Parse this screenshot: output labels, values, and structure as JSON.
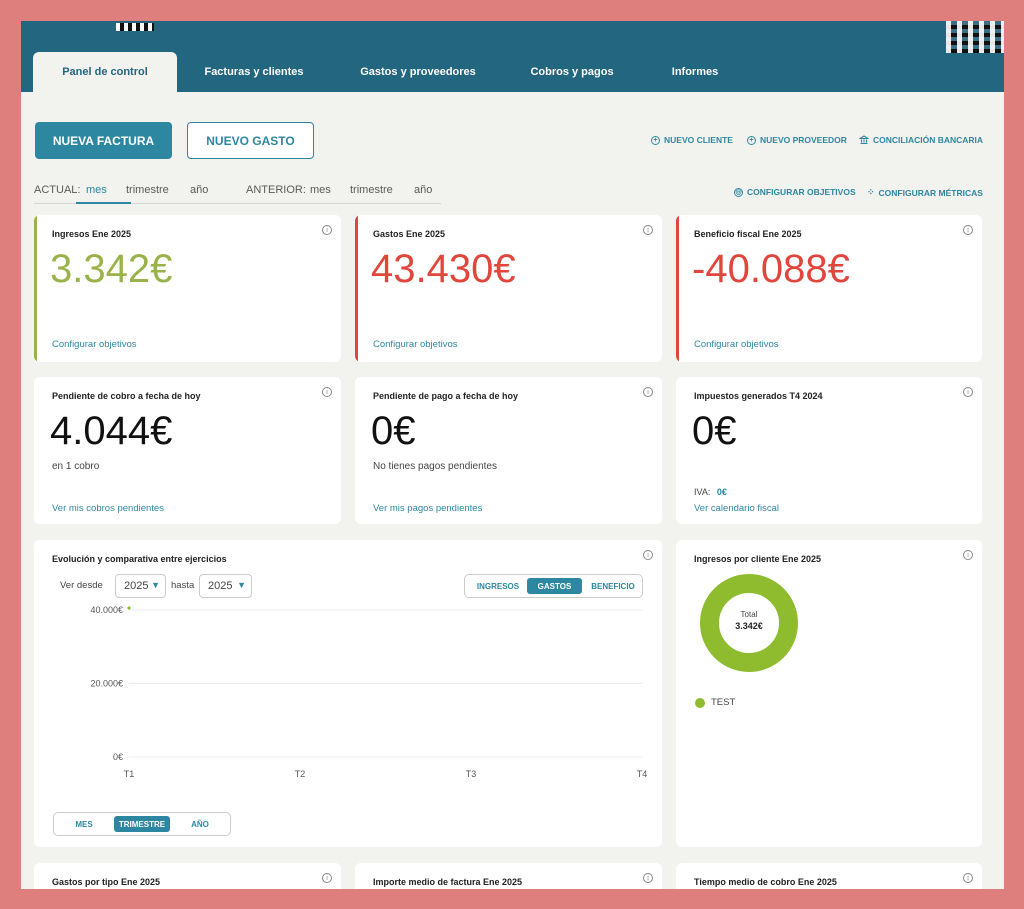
{
  "tabs": [
    {
      "label": "Panel de control"
    },
    {
      "label": "Facturas y clientes"
    },
    {
      "label": "Gastos y proveedores"
    },
    {
      "label": "Cobros y pagos"
    },
    {
      "label": "Informes"
    }
  ],
  "actions": {
    "new_invoice": "NUEVA FACTURA",
    "new_expense": "NUEVO GASTO",
    "new_client": "NUEVO CLIENTE",
    "new_supplier": "NUEVO PROVEEDOR",
    "bank_reconciliation": "CONCILIACIÓN BANCARIA",
    "configure_goals": "CONFIGURAR OBJETIVOS",
    "configure_metrics": "CONFIGURAR MÉTRICAS"
  },
  "periods": {
    "current_label": "ACTUAL:",
    "previous_label": "ANTERIOR:",
    "options": [
      "mes",
      "trimestre",
      "año"
    ],
    "selected": "mes"
  },
  "cards": {
    "income": {
      "title": "Ingresos Ene 2025",
      "value": "3.342€",
      "link": "Configurar objetivos",
      "color": "#9ab24a"
    },
    "expenses": {
      "title": "Gastos Ene 2025",
      "value": "43.430€",
      "link": "Configurar objetivos",
      "color": "#e1463c"
    },
    "profit": {
      "title": "Beneficio fiscal Ene 2025",
      "value": "-40.088€",
      "link": "Configurar objetivos",
      "color": "#e1463c"
    },
    "receivable": {
      "title": "Pendiente de cobro a fecha de hoy",
      "value": "4.044€",
      "sub": "en 1 cobro",
      "link": "Ver mis cobros pendientes"
    },
    "payable": {
      "title": "Pendiente de pago a fecha de hoy",
      "value": "0€",
      "sub": "No tienes pagos pendientes",
      "link": "Ver mis pagos pendientes"
    },
    "taxes": {
      "title": "Impuestos generados T4 2024",
      "value": "0€",
      "iva_label": "IVA:",
      "iva_value": "0€",
      "link": "Ver calendario fiscal"
    }
  },
  "evolution": {
    "title": "Evolución y comparativa entre ejercicios",
    "from_label": "Ver desde",
    "to_label": "hasta",
    "from_value": "2025",
    "to_value": "2025",
    "metric_options": [
      "INGRESOS",
      "GASTOS",
      "BENEFICIO"
    ],
    "metric_selected": "GASTOS",
    "granularity_options": [
      "MES",
      "TRIMESTRE",
      "AÑO"
    ],
    "granularity_selected": "TRIMESTRE"
  },
  "client_income": {
    "title": "Ingresos por cliente Ene 2025",
    "total_label": "Total",
    "total_value": "3.342€",
    "legend": "TEST",
    "color": "#8fbc2f"
  },
  "bottom_cards": [
    {
      "title": "Gastos por tipo Ene 2025"
    },
    {
      "title": "Importe medio de factura Ene 2025"
    },
    {
      "title": "Tiempo medio de cobro Ene 2025"
    }
  ],
  "chart_data": {
    "type": "line",
    "categories": [
      "T1",
      "T2",
      "T3",
      "T4"
    ],
    "series": [
      {
        "values": [
          43430,
          null,
          null,
          null
        ],
        "color": "#8fbc2f"
      }
    ],
    "ylabel": "",
    "xlabel": "",
    "y_ticks": [
      "0€",
      "20.000€",
      "40.000€"
    ],
    "y_tick_values": [
      0,
      20000,
      40000
    ],
    "ylim": [
      0,
      40000
    ],
    "grid": true
  }
}
